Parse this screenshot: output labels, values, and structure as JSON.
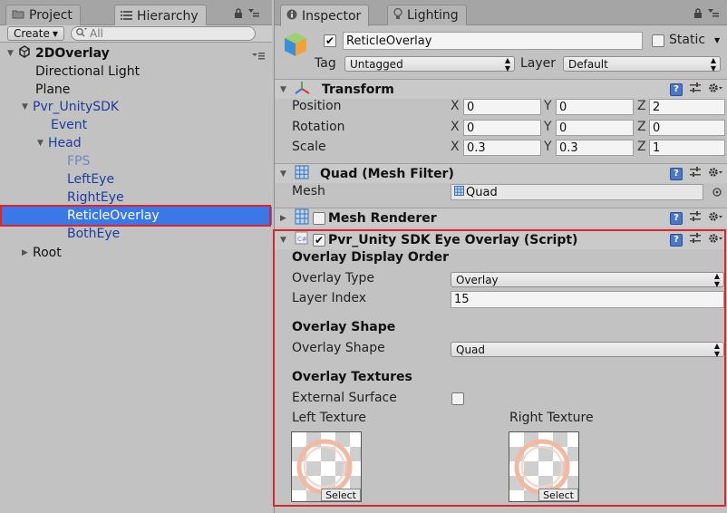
{
  "left_tabs": {
    "project": "Project",
    "hierarchy": "Hierarchy"
  },
  "hierarchy_toolbar": {
    "create_label": "Create",
    "search_placeholder": "All"
  },
  "scene_name": "2DOverlay",
  "tree": [
    {
      "label": "Directional Light"
    },
    {
      "label": "Plane"
    },
    {
      "label": "Pvr_UnitySDK"
    },
    {
      "label": "Event"
    },
    {
      "label": "Head"
    },
    {
      "label": "FPS"
    },
    {
      "label": "LeftEye"
    },
    {
      "label": "RightEye"
    },
    {
      "label": "ReticleOverlay"
    },
    {
      "label": "BothEye"
    },
    {
      "label": "Root"
    }
  ],
  "right_tabs": {
    "inspector": "Inspector",
    "lighting": "Lighting"
  },
  "object": {
    "name": "ReticleOverlay",
    "static_label": "Static",
    "tag_label": "Tag",
    "tag_value": "Untagged",
    "layer_label": "Layer",
    "layer_value": "Default"
  },
  "transform": {
    "title": "Transform",
    "position_label": "Position",
    "rotation_label": "Rotation",
    "scale_label": "Scale",
    "axes": {
      "x": "X",
      "y": "Y",
      "z": "Z"
    },
    "position": {
      "x": "0",
      "y": "0",
      "z": "2"
    },
    "rotation": {
      "x": "0",
      "y": "0",
      "z": "0"
    },
    "scale": {
      "x": "0.3",
      "y": "0.3",
      "z": "1"
    }
  },
  "mesh_filter": {
    "title": "Quad (Mesh Filter)",
    "mesh_label": "Mesh",
    "mesh_value": "Quad"
  },
  "mesh_renderer": {
    "title": "Mesh Renderer"
  },
  "eye_overlay": {
    "title": "Pvr_Unity SDK Eye Overlay (Script)",
    "display_order_heading": "Overlay Display Order",
    "overlay_type_label": "Overlay Type",
    "overlay_type_value": "Overlay",
    "layer_index_label": "Layer Index",
    "layer_index_value": "15",
    "shape_heading": "Overlay Shape",
    "shape_label": "Overlay Shape",
    "shape_value": "Quad",
    "textures_heading": "Overlay Textures",
    "external_surface_label": "External Surface",
    "left_texture_label": "Left Texture",
    "right_texture_label": "Right Texture",
    "select_label": "Select"
  },
  "colors": {
    "selection": "#3b78e7",
    "highlight_border": "#d9262c",
    "help_icon": "#4a78c8"
  }
}
